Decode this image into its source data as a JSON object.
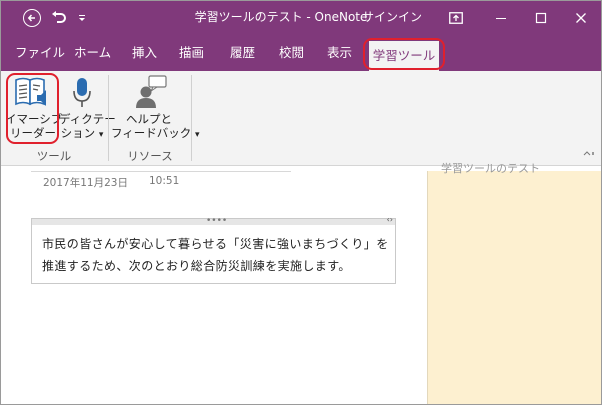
{
  "window": {
    "title": "学習ツールのテスト - OneNote",
    "signin_label": "サインイン"
  },
  "icons": {
    "back": "back-arrow-icon",
    "undo": "undo-icon",
    "qat": "customize-quick-access-icon",
    "ribbon_display": "ribbon-display-options-icon",
    "minimize": "minimize-icon",
    "maximize": "maximize-icon",
    "close": "close-icon",
    "immersive_reader": "book-speaker-icon",
    "dictation": "microphone-icon",
    "help_feedback": "person-speech-bubble-icon"
  },
  "tabs": [
    "ファイル",
    "ホーム",
    "挿入",
    "描画",
    "履歴",
    "校閲",
    "表示"
  ],
  "active_tab": "学習ツール",
  "ribbon": {
    "immersive_reader_line1": "イマーシブ",
    "immersive_reader_line2": "リーダー",
    "dictation_line1": "ディクテー",
    "dictation_line2": "ション",
    "help_line1": "ヘルプと",
    "help_line2": "フィードバック",
    "group_tools": "ツール",
    "group_resources": "リソース",
    "dropdown": "▾",
    "collapse_icon": "collapse-ribbon-icon"
  },
  "page": {
    "date": "2017年11月23日",
    "time": "10:51",
    "side_title": "学習ツールのテスト",
    "note_line1": "市民の皆さんが安心して暮らせる「災害に強いまちづくり」を",
    "note_line2": "推進するため、次のとおり総合防災訓練を実施します。",
    "note_handle_dots": "••••",
    "note_handle_arrows": "‹›"
  },
  "colors": {
    "brand": "#80397b",
    "highlight": "#e0202d",
    "side_pane": "#fdf0d0",
    "icon_blue": "#2b6cb0"
  }
}
